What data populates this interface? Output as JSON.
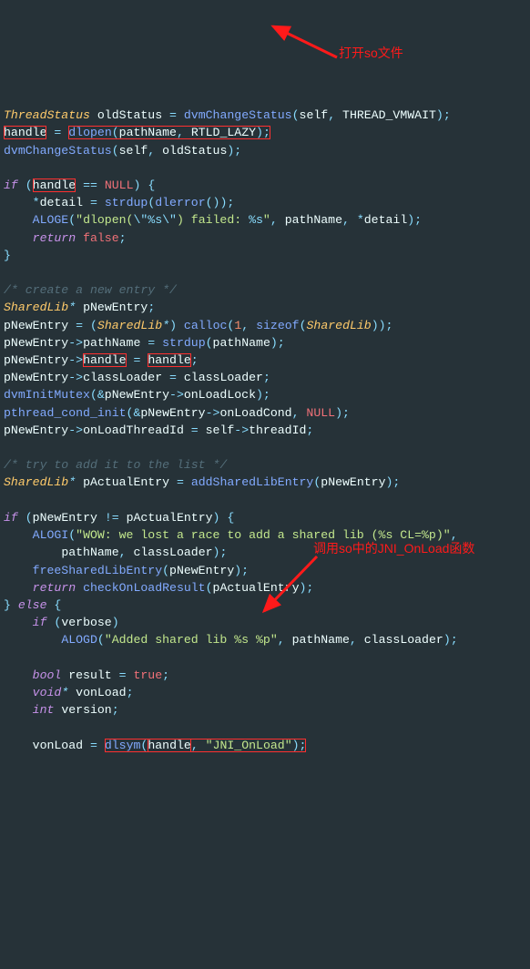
{
  "code": {
    "l0_a": "ThreadStatus",
    "l0_b": "oldStatus",
    "l0_c": "dvmChangeStatus",
    "l0_d": "self",
    "l0_e": "THREAD_VMWAIT",
    "l1_a": "handle",
    "l1_b": "dlopen",
    "l1_c": "pathName",
    "l1_d": "RTLD_LAZY",
    "l2_a": "dvmChangeStatus",
    "l2_b": "self",
    "l2_c": "oldStatus",
    "l4_if": "if",
    "l4_a": "handle",
    "l4_null": "NULL",
    "l5_a": "detail",
    "l5_b": "strdup",
    "l5_c": "dlerror",
    "l6_a": "ALOGE",
    "l6_s1a": "\"dlopen(",
    "l6_e1": "\\\"",
    "l6_p1": "%s",
    "l6_e2": "\\\"",
    "l6_s1b": ") failed: ",
    "l6_p2": "%s",
    "l6_s1c": "\"",
    "l6_b": "pathName",
    "l6_c": "detail",
    "l7_r": "return",
    "l7_f": "false",
    "c1": "/* create a new entry */",
    "l11_cls": "SharedLib",
    "l11_a": "pNewEntry",
    "l12_a": "pNewEntry",
    "l12_cls": "SharedLib",
    "l12_b": "calloc",
    "l12_n": "1",
    "l12_c": "sizeof",
    "l12_cls2": "SharedLib",
    "l13_a": "pNewEntry",
    "l13_f": "pathName",
    "l13_b": "strdup",
    "l13_c": "pathName",
    "l14_a": "pNewEntry",
    "l14_f": "handle",
    "l14_b": "handle",
    "l15_a": "pNewEntry",
    "l15_f": "classLoader",
    "l15_b": "classLoader",
    "l16_a": "dvmInitMutex",
    "l16_b": "pNewEntry",
    "l16_f": "onLoadLock",
    "l17_a": "pthread_cond_init",
    "l17_b": "pNewEntry",
    "l17_f": "onLoadCond",
    "l17_null": "NULL",
    "l18_a": "pNewEntry",
    "l18_f": "onLoadThreadId",
    "l18_b": "self",
    "l18_g": "threadId",
    "c2": "/* try to add it to the list */",
    "l21_cls": "SharedLib",
    "l21_a": "pActualEntry",
    "l21_b": "addSharedLibEntry",
    "l21_c": "pNewEntry",
    "l23_if": "if",
    "l23_a": "pNewEntry",
    "l23_b": "pActualEntry",
    "l24_a": "ALOGI",
    "l24_s": "\"WOW: we lost a race to add a shared lib (%s CL=%p)\"",
    "l25_a": "pathName",
    "l25_b": "classLoader",
    "l26_a": "freeSharedLibEntry",
    "l26_b": "pNewEntry",
    "l27_r": "return",
    "l27_a": "checkOnLoadResult",
    "l27_b": "pActualEntry",
    "l28_e": "else",
    "l29_if": "if",
    "l29_a": "verbose",
    "l30_a": "ALOGD",
    "l30_s": "\"Added shared lib %s %p\"",
    "l30_b": "pathName",
    "l30_c": "classLoader",
    "l32_t": "bool",
    "l32_a": "result",
    "l32_b": "true",
    "l33_t": "void",
    "l33_a": "vonLoad",
    "l34_t": "int",
    "l34_a": "version",
    "l36_a": "vonLoad",
    "l36_b": "dlsym",
    "l36_c": "handle",
    "l36_s": "\"JNI_OnLoad\""
  },
  "annotations": {
    "a1": "打开so文件",
    "a2": "调用so中的JNI_OnLoad函数"
  }
}
